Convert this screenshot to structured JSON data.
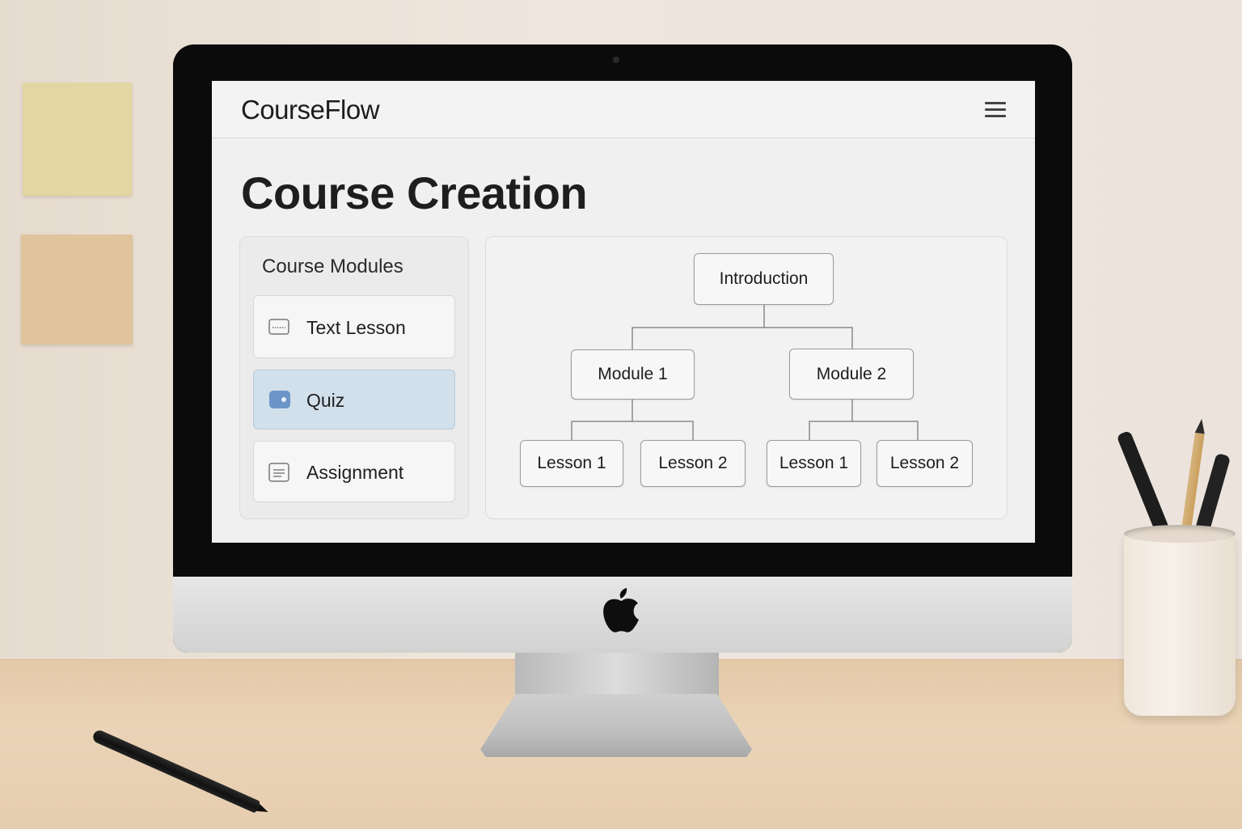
{
  "app": {
    "brand": "CourseFlow",
    "page_title": "Course Creation"
  },
  "sidebar": {
    "title": "Course Modules",
    "items": [
      {
        "label": "Text Lesson",
        "icon": "text-lesson-icon",
        "selected": false
      },
      {
        "label": "Quiz",
        "icon": "quiz-icon",
        "selected": true
      },
      {
        "label": "Assignment",
        "icon": "assignment-icon",
        "selected": false
      }
    ]
  },
  "tree": {
    "root": "Introduction",
    "modules": [
      {
        "label": "Module 1",
        "lessons": [
          "Lesson 1",
          "Lesson 2"
        ]
      },
      {
        "label": "Module 2",
        "lessons": [
          "Lesson 1",
          "Lesson 2"
        ]
      }
    ]
  },
  "colors": {
    "selected_item_bg": "#d2e0ec",
    "quiz_icon": "#6b95c8",
    "screen_bg": "#f0f0f0"
  }
}
